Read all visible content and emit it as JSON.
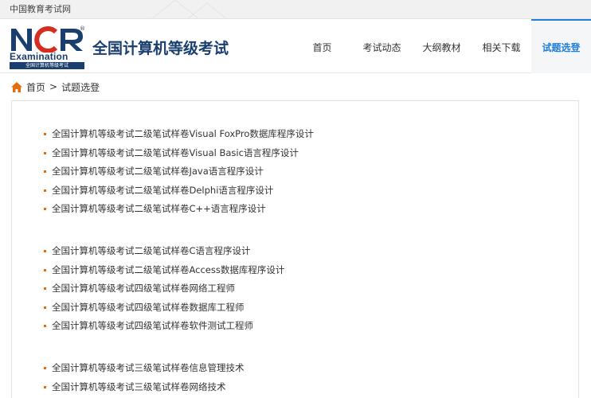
{
  "topbar": {
    "site_link": "中国教育考试网"
  },
  "logo": {
    "letters": "NCR",
    "reg": "®",
    "exam": "Examination",
    "strip": "全国计算机等级考试"
  },
  "header": {
    "title": "全国计算机等级考试"
  },
  "nav": [
    {
      "label": "首页"
    },
    {
      "label": "考试动态"
    },
    {
      "label": "大纲教材"
    },
    {
      "label": "相关下载"
    },
    {
      "label": "试题选登"
    }
  ],
  "breadcrumb": {
    "home": "首页",
    "sep": ">",
    "current": "试题选登"
  },
  "groups": [
    [
      "全国计算机等级考试二级笔试样卷Visual FoxPro数据库程序设计",
      "全国计算机等级考试二级笔试样卷Visual Basic语言程序设计",
      "全国计算机等级考试二级笔试样卷Java语言程序设计",
      "全国计算机等级考试二级笔试样卷Delphi语言程序设计",
      "全国计算机等级考试二级笔试样卷C++语言程序设计"
    ],
    [
      "全国计算机等级考试二级笔试样卷C语言程序设计",
      "全国计算机等级考试二级笔试样卷Access数据库程序设计",
      "全国计算机等级考试四级笔试样卷网络工程师",
      "全国计算机等级考试四级笔试样卷数据库工程师",
      "全国计算机等级考试四级笔试样卷软件测试工程师"
    ],
    [
      "全国计算机等级考试三级笔试样卷信息管理技术",
      "全国计算机等级考试三级笔试样卷网络技术"
    ]
  ],
  "colors": {
    "brand_blue": "#1a3f6e",
    "brand_red": "#d62d20",
    "active_nav": "#1f7fd8",
    "bullet": "#e56c0c"
  }
}
